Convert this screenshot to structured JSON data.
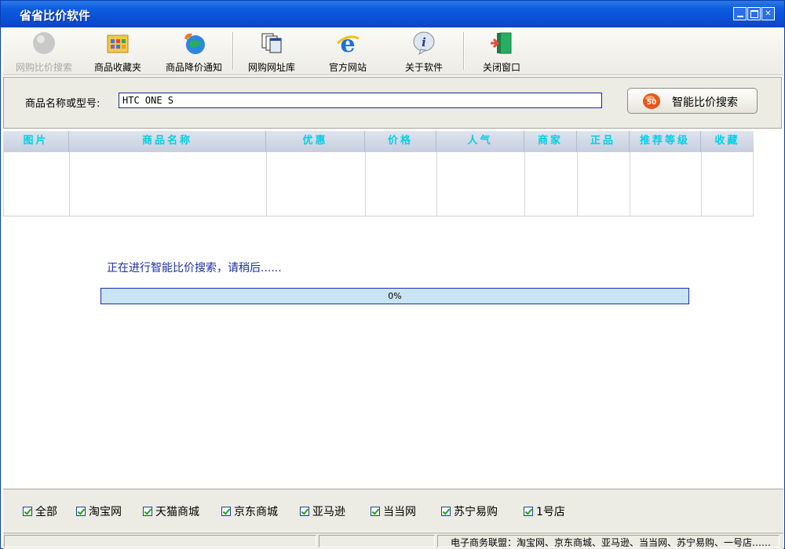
{
  "window": {
    "title": "省省比价软件"
  },
  "toolbar": {
    "items": [
      {
        "label": "网购比价搜索",
        "icon": "gray-ball-icon",
        "disabled": true
      },
      {
        "label": "商品收藏夹",
        "icon": "folder-grid-icon"
      },
      {
        "label": "商品降价通知",
        "icon": "globe-phone-icon"
      },
      {
        "label": "网购网址库",
        "icon": "windows-stack-icon"
      },
      {
        "label": "官方网站",
        "icon": "ie-icon"
      },
      {
        "label": "关于软件",
        "icon": "info-icon"
      },
      {
        "label": "关闭窗口",
        "icon": "exit-door-icon"
      }
    ]
  },
  "search": {
    "label": "商品名称或型号:",
    "value": "HTC ONE S",
    "button_label": "智能比价搜索",
    "button_icon_text": "50"
  },
  "table": {
    "columns": [
      "图片",
      "商品名称",
      "优惠",
      "价格",
      "人气",
      "商家",
      "正品",
      "推荐等级",
      "收藏"
    ]
  },
  "progress": {
    "message": "正在进行智能比价搜索，请稍后......",
    "percent_label": "0%",
    "value": 0
  },
  "filters": [
    {
      "label": "全部",
      "checked": true
    },
    {
      "label": "淘宝网",
      "checked": true
    },
    {
      "label": "天猫商城",
      "checked": true
    },
    {
      "label": "京东商城",
      "checked": true
    },
    {
      "label": "亚马逊",
      "checked": true
    },
    {
      "label": "当当网",
      "checked": true
    },
    {
      "label": "苏宁易购",
      "checked": true
    },
    {
      "label": "1号店",
      "checked": true
    }
  ],
  "status": {
    "text": "电子商务联盟：淘宝网、京东商城、亚马逊、当当网、苏宁易购、一号店……"
  },
  "colors": {
    "titlebar": "#0a4fd4",
    "header_text": "#00d0e6",
    "progress_text": "#1c2fa8",
    "progress_bg": "#c8e4f6"
  }
}
